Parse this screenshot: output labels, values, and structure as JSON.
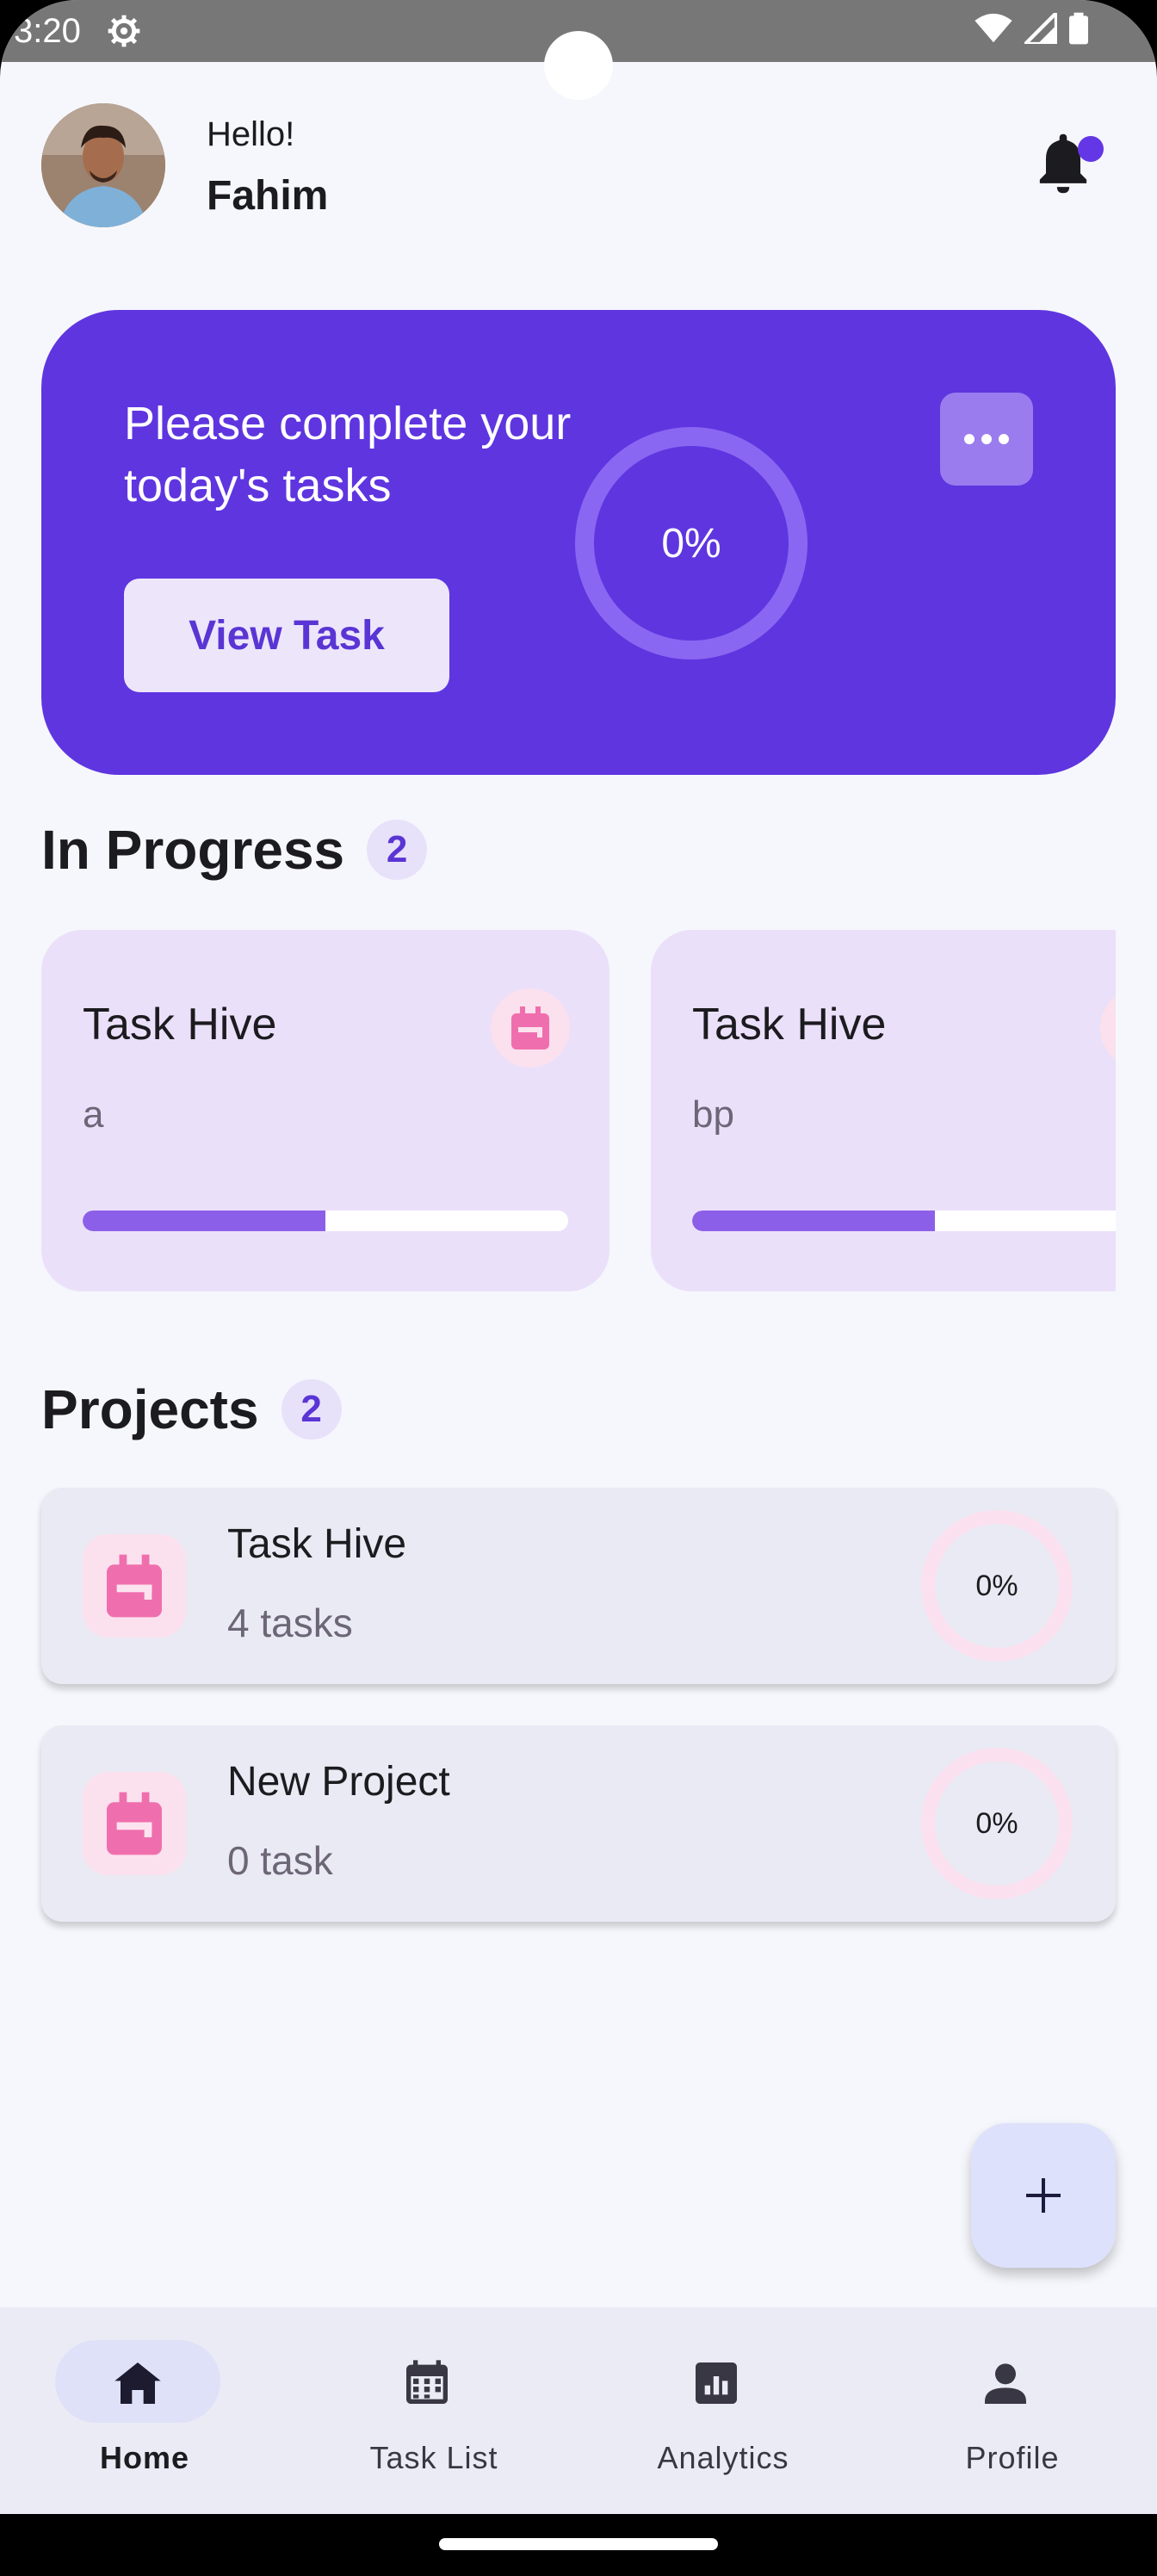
{
  "status_bar": {
    "time": "3:20"
  },
  "header": {
    "greeting": "Hello!",
    "user_name": "Fahim"
  },
  "hero": {
    "title": "Please complete your today's tasks",
    "button_label": "View Task",
    "progress_label": "0%",
    "progress_fraction": 0.0,
    "accent_color": "#5f35e0"
  },
  "in_progress": {
    "heading": "In Progress",
    "count": "2",
    "cards": [
      {
        "title": "Task Hive",
        "subtitle": "a",
        "progress_fraction": 0.5
      },
      {
        "title": "Task Hive",
        "subtitle": "bp",
        "progress_fraction": 0.5
      }
    ]
  },
  "projects": {
    "heading": "Projects",
    "count": "2",
    "items": [
      {
        "title": "Task Hive",
        "subtitle": "4 tasks",
        "percent": "0%"
      },
      {
        "title": "New Project",
        "subtitle": "0 task",
        "percent": "0%"
      }
    ]
  },
  "bottom_nav": {
    "items": [
      {
        "label": "Home",
        "icon": "home-icon",
        "active": true
      },
      {
        "label": "Task List",
        "icon": "calendar-icon",
        "active": false
      },
      {
        "label": "Analytics",
        "icon": "analytics-icon",
        "active": false
      },
      {
        "label": "Profile",
        "icon": "person-icon",
        "active": false
      }
    ]
  }
}
